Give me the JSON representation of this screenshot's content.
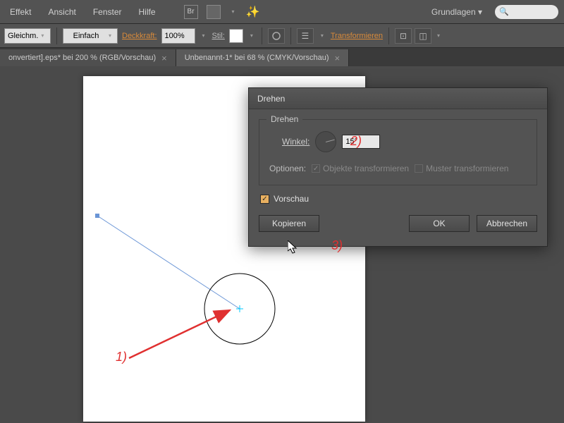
{
  "menu": {
    "items": [
      "Effekt",
      "Ansicht",
      "Fenster",
      "Hilfe"
    ],
    "workspace": "Grundlagen",
    "br": "Br"
  },
  "toolbar": {
    "stroke_cap": "Gleichm.",
    "stroke_style": "Einfach",
    "opacity_label": "Deckkraft:",
    "opacity_value": "100%",
    "style_label": "Stil:",
    "transform_label": "Transformieren"
  },
  "tabs": [
    {
      "label": "onvertiert].eps* bei 200 % (RGB/Vorschau)",
      "active": false
    },
    {
      "label": "Unbenannt-1* bei 68 % (CMYK/Vorschau)",
      "active": true
    }
  ],
  "dialog": {
    "title": "Drehen",
    "group_title": "Drehen",
    "angle_label": "Winkel:",
    "angle_value": "15°",
    "options_label": "Optionen:",
    "opt_objects": "Objekte transformieren",
    "opt_patterns": "Muster transformieren",
    "preview_label": "Vorschau",
    "btn_copy": "Kopieren",
    "btn_ok": "OK",
    "btn_cancel": "Abbrechen"
  },
  "annotations": {
    "a1": "1)",
    "a2": "2)",
    "a3": "3)"
  },
  "icons": {
    "search": "🔍",
    "wand": "✨",
    "dropdown": "▾",
    "check": "✓",
    "close": "×"
  }
}
